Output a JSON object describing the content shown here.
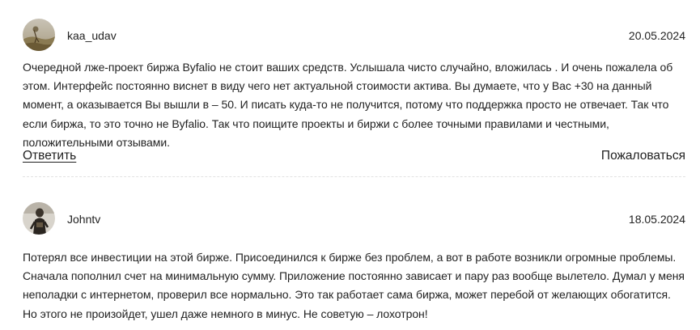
{
  "reviews": [
    {
      "author": "kaa_udav",
      "date": "20.05.2024",
      "avatar_icon": "landscape-photo-avatar",
      "text": "Очередной лже-проект биржа Byfalio не стоит ваших средств. Услышала чисто случайно, вложилась . И очень пожалела об этом. Интерфейс постоянно виснет в виду чего нет актуальной стоимости актива. Вы думаете, что у Вас +30 на данный момент, а оказывается Вы вышли в – 50. И писать куда-то не получится, потому что поддержка просто не отвечает. Так что если биржа, то это точно не Byfalio. Так что поищите проекты и биржи с более точными правилами и честными, положительными отзывами."
    },
    {
      "author": "Johntv",
      "date": "18.05.2024",
      "avatar_icon": "person-photo-avatar",
      "text": "Потерял все инвестиции на этой бирже. Присоединился к бирже без проблем, а вот в работе возникли огромные проблемы. Сначала пополнил счет на минимальную сумму. Приложение постоянно зависает и пару раз вообще вылетело. Думал у меня неполадки с интернетом, проверил все нормально. Это так работает сама биржа, может перебой от желающих обогатится. Но этого не произойдет, ушел даже немного в минус. Не советую – лохотрон!"
    }
  ],
  "actions": {
    "reply_label": "Ответить",
    "report_label": "Пожаловаться"
  }
}
